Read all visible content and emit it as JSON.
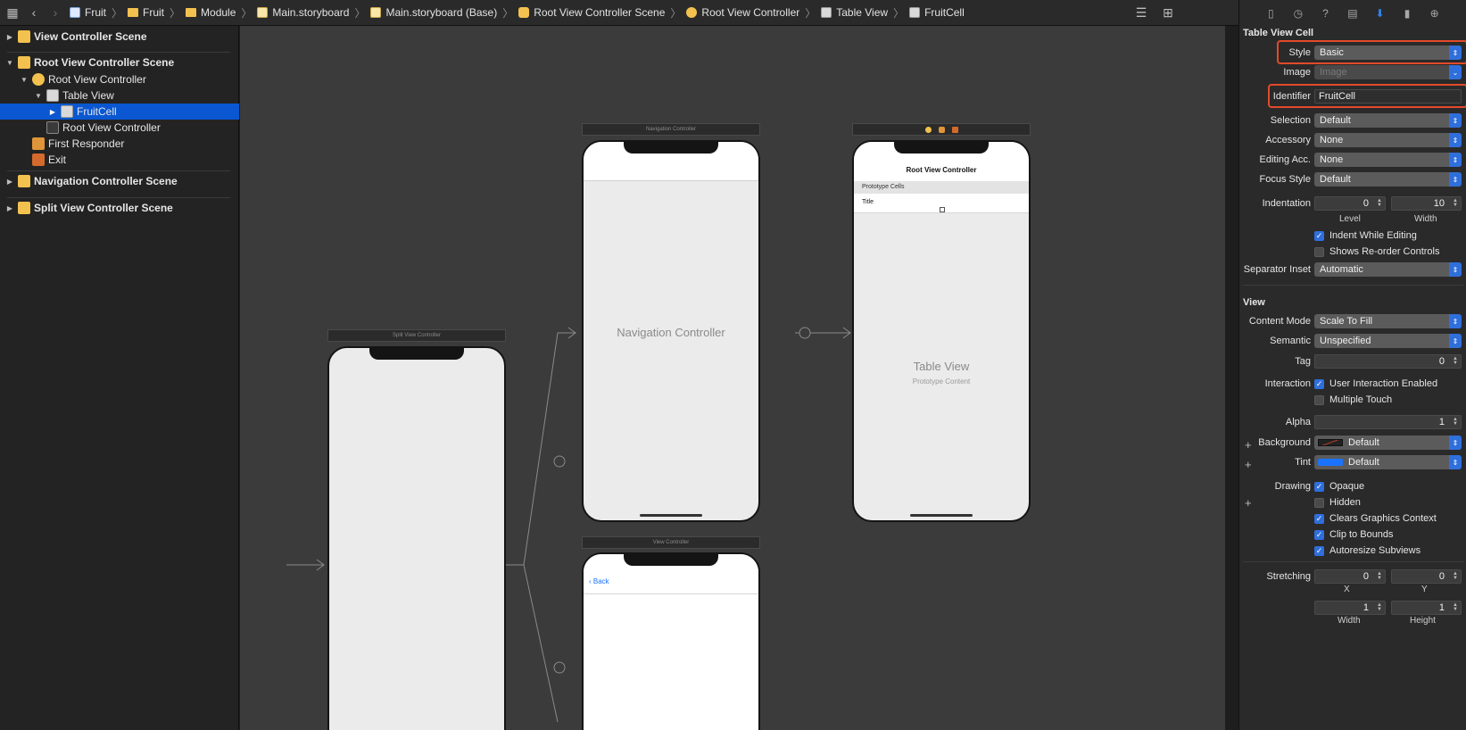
{
  "breadcrumbs": [
    "Fruit",
    "Fruit",
    "Module",
    "Main.storyboard",
    "Main.storyboard (Base)",
    "Root View Controller Scene",
    "Root View Controller",
    "Table View",
    "FruitCell"
  ],
  "navigator": {
    "view_controller_scene": "View Controller Scene",
    "root_scene": "Root View Controller Scene",
    "root_vc": "Root View Controller",
    "table_view": "Table View",
    "fruit_cell": "FruitCell",
    "root_vc_nav": "Root View Controller",
    "first_responder": "First Responder",
    "exit": "Exit",
    "nav_scene": "Navigation Controller Scene",
    "split_scene": "Split View Controller Scene"
  },
  "canvas": {
    "split_bar": "Split View Controller",
    "nav_bar": "Navigation Controller",
    "nav_center": "Navigation Controller",
    "vc_bar": "View Controller",
    "back": "Back",
    "root_title": "Root View Controller",
    "prototype_cells": "Prototype Cells",
    "title_cell": "Title",
    "table_view": "Table View",
    "prototype_content": "Prototype Content"
  },
  "inspector": {
    "section_cell": "Table View Cell",
    "style_label": "Style",
    "style_value": "Basic",
    "image_label": "Image",
    "image_placeholder": "Image",
    "identifier_label": "Identifier",
    "identifier_value": "FruitCell",
    "selection_label": "Selection",
    "selection_value": "Default",
    "accessory_label": "Accessory",
    "accessory_value": "None",
    "editing_label": "Editing Acc.",
    "editing_value": "None",
    "focus_label": "Focus Style",
    "focus_value": "Default",
    "indentation_label": "Indentation",
    "indent_level": "0",
    "indent_width": "10",
    "level_label": "Level",
    "width_label": "Width",
    "indent_while_editing": "Indent While Editing",
    "shows_reorder": "Shows Re-order Controls",
    "separator_label": "Separator Inset",
    "separator_value": "Automatic",
    "section_view": "View",
    "content_mode_label": "Content Mode",
    "content_mode_value": "Scale To Fill",
    "semantic_label": "Semantic",
    "semantic_value": "Unspecified",
    "tag_label": "Tag",
    "tag_value": "0",
    "interaction_label": "Interaction",
    "user_interaction": "User Interaction Enabled",
    "multiple_touch": "Multiple Touch",
    "alpha_label": "Alpha",
    "alpha_value": "1",
    "background_label": "Background",
    "background_value": "Default",
    "tint_label": "Tint",
    "tint_value": "Default",
    "drawing_label": "Drawing",
    "opaque": "Opaque",
    "hidden": "Hidden",
    "clears_graphics": "Clears Graphics Context",
    "clip_to_bounds": "Clip to Bounds",
    "autoresize": "Autoresize Subviews",
    "stretching_label": "Stretching",
    "stretch_x": "0",
    "stretch_y": "0",
    "stretch_w": "1",
    "stretch_h": "1",
    "x_label": "X",
    "y_label": "Y",
    "w_label": "Width",
    "h_label": "Height"
  },
  "colors": {
    "accent": "#2f6fdc",
    "selection": "#0a57d1",
    "highlight": "#e24a2a",
    "tint": "#1a73ff"
  }
}
